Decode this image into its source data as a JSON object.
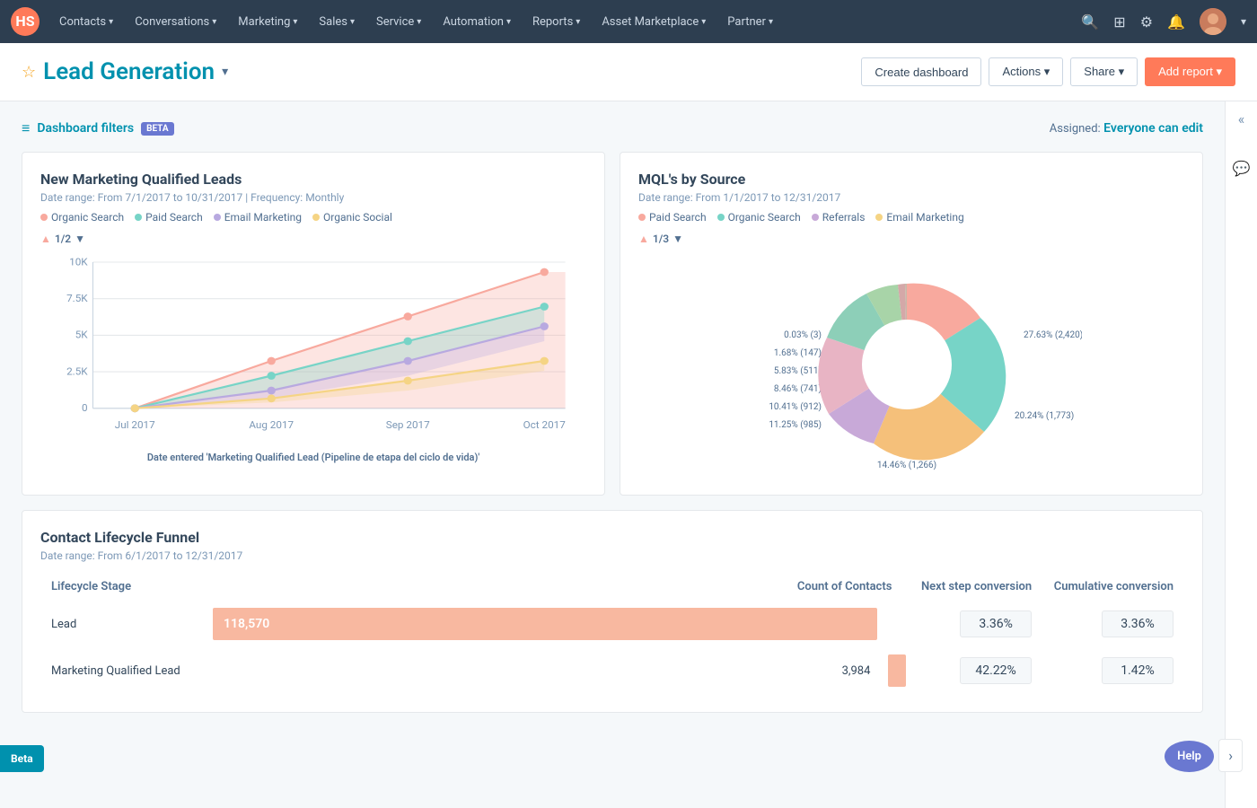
{
  "topnav": {
    "logo": "hubspot-logo",
    "items": [
      {
        "label": "Contacts",
        "id": "contacts"
      },
      {
        "label": "Conversations",
        "id": "conversations"
      },
      {
        "label": "Marketing",
        "id": "marketing"
      },
      {
        "label": "Sales",
        "id": "sales"
      },
      {
        "label": "Service",
        "id": "service"
      },
      {
        "label": "Automation",
        "id": "automation"
      },
      {
        "label": "Reports",
        "id": "reports"
      },
      {
        "label": "Asset Marketplace",
        "id": "asset-marketplace"
      },
      {
        "label": "Partner",
        "id": "partner"
      }
    ]
  },
  "header": {
    "title": "Lead Generation",
    "create_dashboard": "Create dashboard",
    "actions": "Actions",
    "share": "Share",
    "add_report": "Add report"
  },
  "filter_bar": {
    "label": "Dashboard filters",
    "beta": "BETA",
    "assigned_prefix": "Assigned:",
    "assigned_link": "Everyone can edit"
  },
  "chart1": {
    "title": "New Marketing Qualified Leads",
    "subtitle": "Date range: From 7/1/2017 to 10/31/2017  |  Frequency: Monthly",
    "legend": [
      {
        "label": "Organic Search",
        "color": "#f8a99e"
      },
      {
        "label": "Paid Search",
        "color": "#77d4c7"
      },
      {
        "label": "Email Marketing",
        "color": "#b8a9e0"
      },
      {
        "label": "Organic Social",
        "color": "#f5d484"
      }
    ],
    "pagination": "1/2",
    "x_labels": [
      "Jul 2017",
      "Aug 2017",
      "Sep 2017",
      "Oct 2017"
    ],
    "y_labels": [
      "0",
      "2.5K",
      "5K",
      "7.5K",
      "10K"
    ],
    "x_axis_label": "Date entered 'Marketing Qualified Lead (Pipeline de etapa del ciclo de vida)'"
  },
  "chart2": {
    "title": "MQL's by Source",
    "subtitle": "Date range: From 1/1/2017 to 12/31/2017",
    "legend": [
      {
        "label": "Paid Search",
        "color": "#f8a99e"
      },
      {
        "label": "Organic Search",
        "color": "#77d4c7"
      },
      {
        "label": "Referrals",
        "color": "#c8a9d8"
      },
      {
        "label": "Email Marketing",
        "color": "#f5d484"
      }
    ],
    "pagination": "1/3",
    "segments": [
      {
        "label": "27.63% (2,420)",
        "percent": 27.63,
        "color": "#f8a99e",
        "angle": 0
      },
      {
        "label": "20.24% (1,773)",
        "percent": 20.24,
        "color": "#77d4c7",
        "angle": 99
      },
      {
        "label": "14.46% (1,266)",
        "percent": 14.46,
        "color": "#f5c07a",
        "angle": 172
      },
      {
        "label": "11.25% (985)",
        "percent": 11.25,
        "color": "#c8a9d8",
        "angle": 224
      },
      {
        "label": "10.41% (912)",
        "percent": 10.41,
        "color": "#e8b4c4",
        "angle": 264
      },
      {
        "label": "8.46% (741)",
        "percent": 8.46,
        "color": "#8dcfb8",
        "angle": 302
      },
      {
        "label": "5.83% (511)",
        "percent": 5.83,
        "color": "#a8d4a8",
        "angle": 332
      },
      {
        "label": "1.68% (147)",
        "percent": 1.68,
        "color": "#d4a8a8",
        "angle": 353
      },
      {
        "label": "0.03% (3)",
        "percent": 0.03,
        "color": "#c8b8a8",
        "angle": 359
      }
    ]
  },
  "funnel": {
    "title": "Contact Lifecycle Funnel",
    "subtitle": "Date range: From 6/1/2017 to 12/31/2017",
    "col_lifecycle": "Lifecycle Stage",
    "col_contacts": "Count of Contacts",
    "col_next_step": "Next step conversion",
    "col_cumulative": "Cumulative conversion",
    "rows": [
      {
        "stage": "Lead",
        "count": "118,570",
        "bar_width_pct": 100,
        "next_step": "3.36%",
        "cumulative": "3.36%"
      },
      {
        "stage": "Marketing Qualified Lead",
        "count": "3,984",
        "bar_width_pct": 3.4,
        "next_step": "42.22%",
        "cumulative": "1.42%"
      }
    ]
  },
  "beta_float": "Beta",
  "help_float": "Help",
  "sidebar": {
    "collapse_icon": "«",
    "chat_icon": "💬"
  }
}
